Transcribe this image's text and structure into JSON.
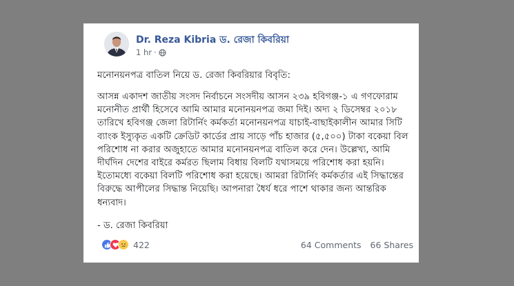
{
  "post": {
    "author": "Dr. Reza Kibria ড. রেজা কিবরিয়া",
    "time": "1 hr",
    "privacy_icon": "globe-icon",
    "heading": "মনোনয়নপত্র বাতিল নিয়ে ড. রেজা কিবরিয়ার বিবৃতি:",
    "body": "আসন্ন একাদশ জাতীয় সংসদ নির্বাচনে সংসদীয় আসন ২৩৯ হবিগঞ্জ-১ এ গণফোরাম মনোনীত প্রার্থী হিসেবে আমি আমার মনোনয়নপত্র জমা দিই। অদ্য ২ ডিসেম্বর ২০১৮ তারিখে হবিগঞ্জ জেলা রিটার্নিং কর্মকর্তা মনোনয়নপত্র যাচাই-বাছাইকালীন আমার সিটি ব্যাংক ইস্যুকৃত একটি ক্রেডিট কার্ডের প্রায় সাড়ে পাঁচ হাজার (৫,৫০০) টাকা বকেয়া বিল পরিশোধ না করার অজুহাতে আমার মনোনয়নপত্র বাতিল করে দেন। উল্লেখ্য, আমি দীর্ঘদিন দেশের বাইরে কর্মরত ছিলাম বিধায় বিলটি যথাসময়ে পরিশোধ করা হয়নি। ইতোমধ্যে বকেয়া বিলটি পরিশোধ করা হয়েছে। আমরা রিটার্নিং কর্মকর্তার এই সিদ্ধান্তের বিরুদ্ধে আপীলের সিদ্ধান্ত নিয়েছি। আপনারা ধৈর্য ধরে পাশে থাকার জন্য আন্তরিক ধন্যবাদ।",
    "signature": "- ড. রেজা কিবরিয়া"
  },
  "engagement": {
    "reaction_icons": [
      "like-icon",
      "love-icon",
      "sad-icon"
    ],
    "reaction_count": "422",
    "comments": "64 Comments",
    "shares": "66 Shares"
  },
  "colors": {
    "background": "#7f7f7f",
    "card": "#ffffff",
    "author_link": "#385898",
    "text": "#1c1e21",
    "meta": "#616770"
  }
}
